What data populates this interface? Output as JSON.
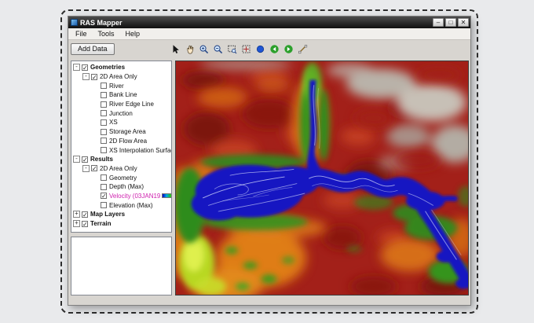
{
  "window": {
    "title": "RAS Mapper",
    "controls": {
      "minimize": "–",
      "maximize": "□",
      "close": "✕"
    }
  },
  "menu_bar": {
    "items": [
      {
        "label": "File"
      },
      {
        "label": "Tools"
      },
      {
        "label": "Help"
      }
    ]
  },
  "toolbar": {
    "add_data_label": "Add Data",
    "icons": [
      "select-cursor-icon",
      "pan-hand-icon",
      "zoom-in-icon",
      "zoom-out-icon",
      "zoom-window-icon",
      "zoom-extent-icon",
      "point-marker-icon",
      "previous-view-icon",
      "next-view-icon",
      "measure-icon"
    ]
  },
  "layer_tree": {
    "items": [
      {
        "label": "Geometries",
        "level": 0,
        "expander": "minus",
        "checked": true,
        "bold": true
      },
      {
        "label": "2D Area Only",
        "level": 1,
        "expander": "minus",
        "checked": true,
        "bold": false
      },
      {
        "label": "River",
        "level": 2,
        "expander": "none",
        "checked": false,
        "bold": false
      },
      {
        "label": "Bank Line",
        "level": 2,
        "expander": "none",
        "checked": false,
        "bold": false
      },
      {
        "label": "River Edge Line",
        "level": 2,
        "expander": "none",
        "checked": false,
        "bold": false
      },
      {
        "label": "Junction",
        "level": 2,
        "expander": "none",
        "checked": false,
        "bold": false
      },
      {
        "label": "XS",
        "level": 2,
        "expander": "none",
        "checked": false,
        "bold": false
      },
      {
        "label": "Storage Area",
        "level": 2,
        "expander": "none",
        "checked": false,
        "bold": false
      },
      {
        "label": "2D Flow Area",
        "level": 2,
        "expander": "none",
        "checked": false,
        "bold": false
      },
      {
        "label": "XS Interpolation Surface",
        "level": 2,
        "expander": "none",
        "checked": false,
        "bold": false
      },
      {
        "label": "Results",
        "level": 0,
        "expander": "minus",
        "checked": true,
        "bold": true
      },
      {
        "label": "2D Area Only",
        "level": 1,
        "expander": "minus",
        "checked": true,
        "bold": false
      },
      {
        "label": "Geometry",
        "level": 2,
        "expander": "none",
        "checked": false,
        "bold": false
      },
      {
        "label": "Depth (Max)",
        "level": 2,
        "expander": "none",
        "checked": false,
        "bold": false
      },
      {
        "label": "Velocity (03JAN19",
        "level": 2,
        "expander": "none",
        "checked": true,
        "bold": false,
        "highlight": "#cf1fae",
        "ramp": true
      },
      {
        "label": "Elevation (Max)",
        "level": 2,
        "expander": "none",
        "checked": false,
        "bold": false
      },
      {
        "label": "Map Layers",
        "level": 0,
        "expander": "plus",
        "checked": true,
        "bold": true
      },
      {
        "label": "Terrain",
        "level": 0,
        "expander": "plus",
        "checked": true,
        "bold": true
      }
    ]
  },
  "colors": {
    "selected_layer_text": "#cf1fae",
    "velocity_ramp": [
      "#0000c8",
      "#00a8e8",
      "#20c020",
      "#f8f000",
      "#e00000"
    ],
    "map_palette": {
      "high_terrain": "#a32019",
      "mid_terrain": "#e07b17",
      "low_terrain": "#2f8c1d",
      "water": "#1217c2",
      "hillshade_gray": "#b9b2a9"
    }
  }
}
